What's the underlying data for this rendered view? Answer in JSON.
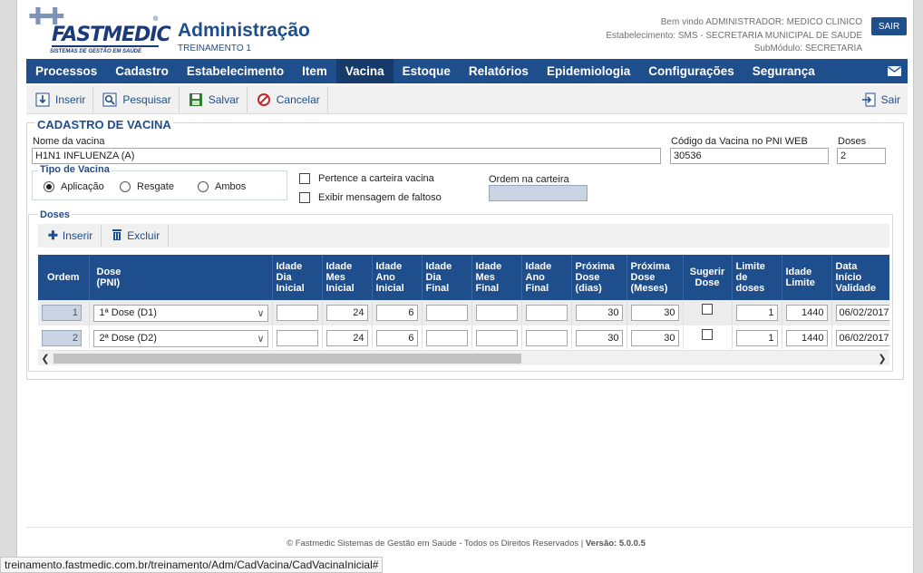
{
  "brand": {
    "name": "FASTMEDIC",
    "reg_mark": "®",
    "tagline": "SISTEMAS DE GESTÃO EM SAÚDE"
  },
  "header": {
    "title": "Administração",
    "subtitle": "TREINAMENTO 1",
    "welcome": "Bem vindo ADMINISTRADOR: MEDICO CLINICO",
    "establishment": "Estabelecimento: SMS - SECRETARIA MUNICIPAL DE SAUDE",
    "submodule": "SubMódulo: SECRETARIA",
    "logout_label": "SAIR"
  },
  "nav": {
    "items": [
      {
        "label": "Processos"
      },
      {
        "label": "Cadastro"
      },
      {
        "label": "Estabelecimento"
      },
      {
        "label": "Item"
      },
      {
        "label": "Vacina"
      },
      {
        "label": "Estoque"
      },
      {
        "label": "Relatórios"
      },
      {
        "label": "Epidemiologia"
      },
      {
        "label": "Configurações"
      },
      {
        "label": "Segurança"
      }
    ],
    "active": "Vacina",
    "mail_icon": "envelope-icon"
  },
  "toolbar": {
    "insert": "Inserir",
    "search": "Pesquisar",
    "save": "Salvar",
    "cancel": "Cancelar",
    "exit": "Sair"
  },
  "form": {
    "section_title": "CADASTRO DE VACINA",
    "vaccine_name_label": "Nome da vacina",
    "vaccine_name_value": "H1N1 INFLUENZA (A)",
    "pni_code_label": "Código da Vacina no PNI WEB",
    "pni_code_value": "30536",
    "doses_label": "Doses",
    "doses_value": "2",
    "vaccine_type_title": "Tipo de Vacina",
    "vaccine_types": [
      "Aplicação",
      "Resgate",
      "Ambos"
    ],
    "vaccine_type_selected": "Aplicação",
    "card_checkbox_label": "Pertence a carteira vacina",
    "missing_msg_checkbox_label": "Exibir mensagem de faltoso",
    "card_order_label": "Ordem na carteira",
    "card_order_value": ""
  },
  "doses": {
    "title": "Doses",
    "insert": "Inserir",
    "delete": "Excluir",
    "columns": [
      "Ordem",
      "Dose (PNI)",
      "Idade Dia Inicial",
      "Idade Mes Inicial",
      "Idade Ano Inicial",
      "Idade Dia Final",
      "Idade Mes Final",
      "Idade Ano Final",
      "Próxima Dose (dias)",
      "Próxima Dose (Meses)",
      "Sugerir Dose",
      "Limite de doses",
      "Idade Limite",
      "Data Início Validade"
    ],
    "rows": [
      {
        "ordem": "1",
        "dose": "1ª Dose (D1)",
        "dia_ini": "",
        "mes_ini": "24",
        "ano_ini": "6",
        "dia_fim": "",
        "mes_fim": "",
        "ano_fim": "",
        "prox_dias": "30",
        "prox_meses": "30",
        "sugerir": false,
        "limite": "1",
        "idade_limite": "1440",
        "data_inicio": "06/02/2017"
      },
      {
        "ordem": "2",
        "dose": "2ª Dose (D2)",
        "dia_ini": "",
        "mes_ini": "24",
        "ano_ini": "6",
        "dia_fim": "",
        "mes_fim": "",
        "ano_fim": "",
        "prox_dias": "30",
        "prox_meses": "30",
        "sugerir": false,
        "limite": "1",
        "idade_limite": "1440",
        "data_inicio": "06/02/2017"
      }
    ]
  },
  "footer": {
    "copyright": "© Fastmedic Sistemas de Gestão em Saúde - Todos os Direitos Reservados |",
    "version_label": "Versão: 5.0.0.5"
  },
  "statusbar": {
    "url": "treinamento.fastmedic.com.br/treinamento/Adm/CadVacina/CadVacinaInicial#"
  }
}
